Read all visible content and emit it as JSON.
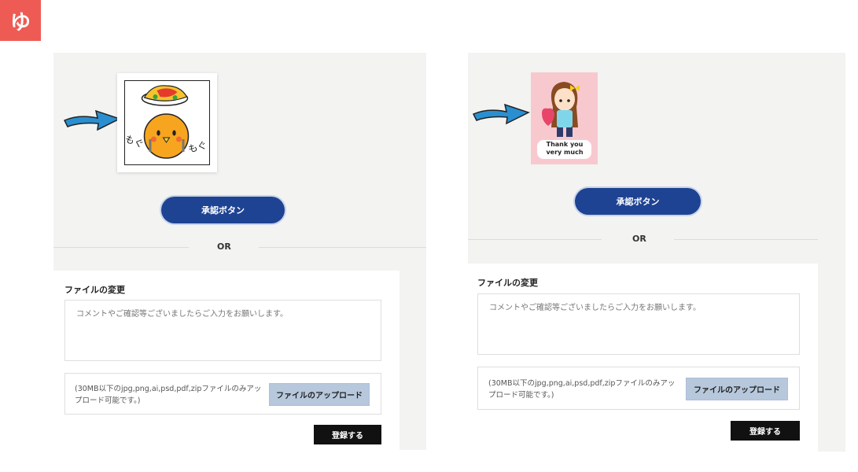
{
  "logo": {
    "text": "ゆ"
  },
  "panels": [
    {
      "approve_label": "承認ボタン",
      "or_label": "OR",
      "form": {
        "title": "ファイルの変更",
        "comment_placeholder": "コメントやご確認等ございましたらご入力をお願いします。",
        "upload_note": "(30MB以下のjpg,png,ai,psd,pdf,zipファイルのみアップロード可能です。)",
        "upload_label": "ファイルのアップロード",
        "submit_label": "登録する"
      },
      "sticker": {
        "caption_left": "もぐ",
        "caption_right": "もぐ"
      }
    },
    {
      "approve_label": "承認ボタン",
      "or_label": "OR",
      "form": {
        "title": "ファイルの変更",
        "comment_placeholder": "コメントやご確認等ございましたらご入力をお願いします。",
        "upload_note": "(30MB以下のjpg,png,ai,psd,pdf,zipファイルのみアップロード可能です。)",
        "upload_label": "ファイルのアップロード",
        "submit_label": "登録する"
      },
      "sticker": {
        "caption": "Thank you very much"
      }
    }
  ],
  "colors": {
    "brand": "#ee5b54",
    "approve": "#1e4393",
    "arrow": "#2a8fd0",
    "upload_button": "#b7c8dc",
    "submit": "#111111"
  }
}
